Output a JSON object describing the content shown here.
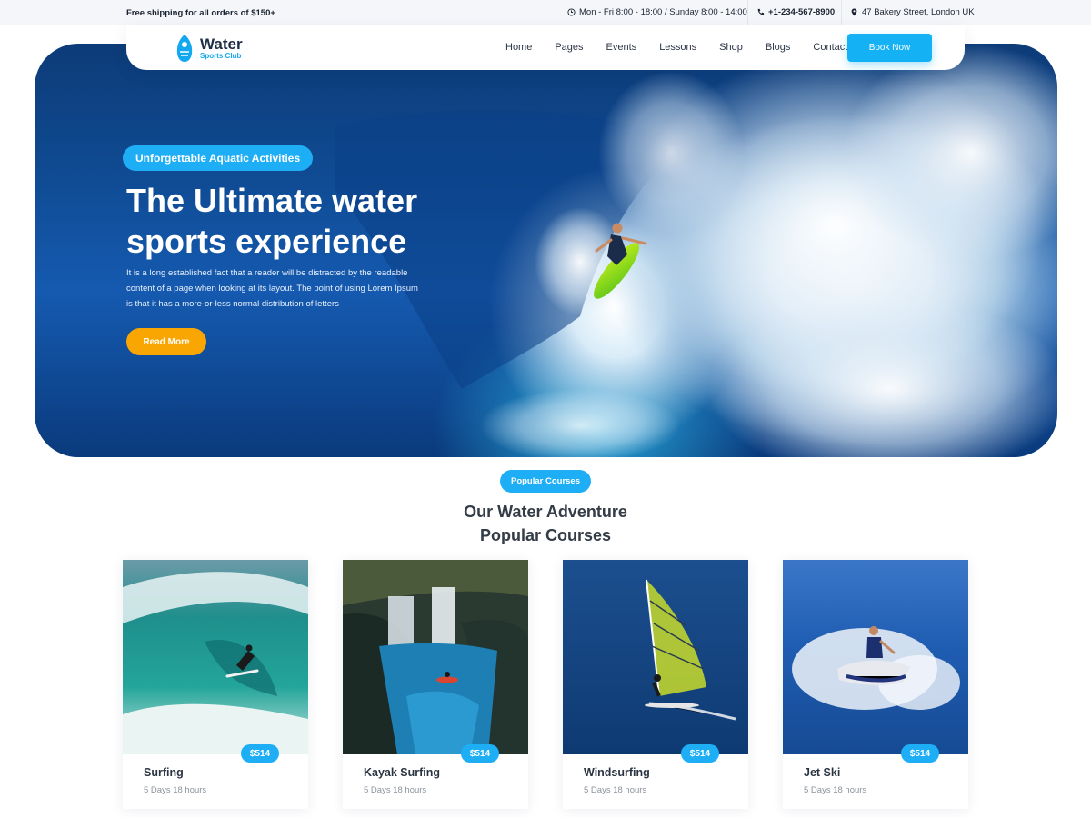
{
  "topbar": {
    "shipping": "Free shipping for all orders of $150+",
    "hours": "Mon - Fri 8:00 - 18:00 / Sunday 8:00 - 14:00",
    "phone": "+1-234-567-8900",
    "address": "47 Bakery Street, London UK"
  },
  "nav": {
    "logo_title": "Water",
    "logo_subtitle": "Sports Club",
    "items": [
      "Home",
      "Pages",
      "Events",
      "Lessons",
      "Shop",
      "Blogs",
      "Contact"
    ],
    "cta": "Book Now"
  },
  "hero": {
    "badge": "Unforgettable Aquatic Activities",
    "title": "The Ultimate water sports experience",
    "text": "It is a long established fact that a reader will be distracted by the readable content of a page when looking at its layout. The point of using Lorem Ipsum is that it has a more-or-less normal distribution of letters",
    "button": "Read More"
  },
  "courses": {
    "badge": "Popular Courses",
    "title_line1": "Our Water Adventure",
    "title_line2": "Popular Courses",
    "items": [
      {
        "title": "Surfing",
        "duration": "5 Days 18 hours",
        "price": "$514"
      },
      {
        "title": "Kayak Surfing",
        "duration": "5 Days 18 hours",
        "price": "$514"
      },
      {
        "title": "Windsurfing",
        "duration": "5 Days 18 hours",
        "price": "$514"
      },
      {
        "title": "Jet Ski",
        "duration": "5 Days 18 hours",
        "price": "$514"
      }
    ]
  },
  "colors": {
    "accent": "#1eaef6",
    "button_orange": "#f9a502",
    "heading": "#333c47"
  }
}
